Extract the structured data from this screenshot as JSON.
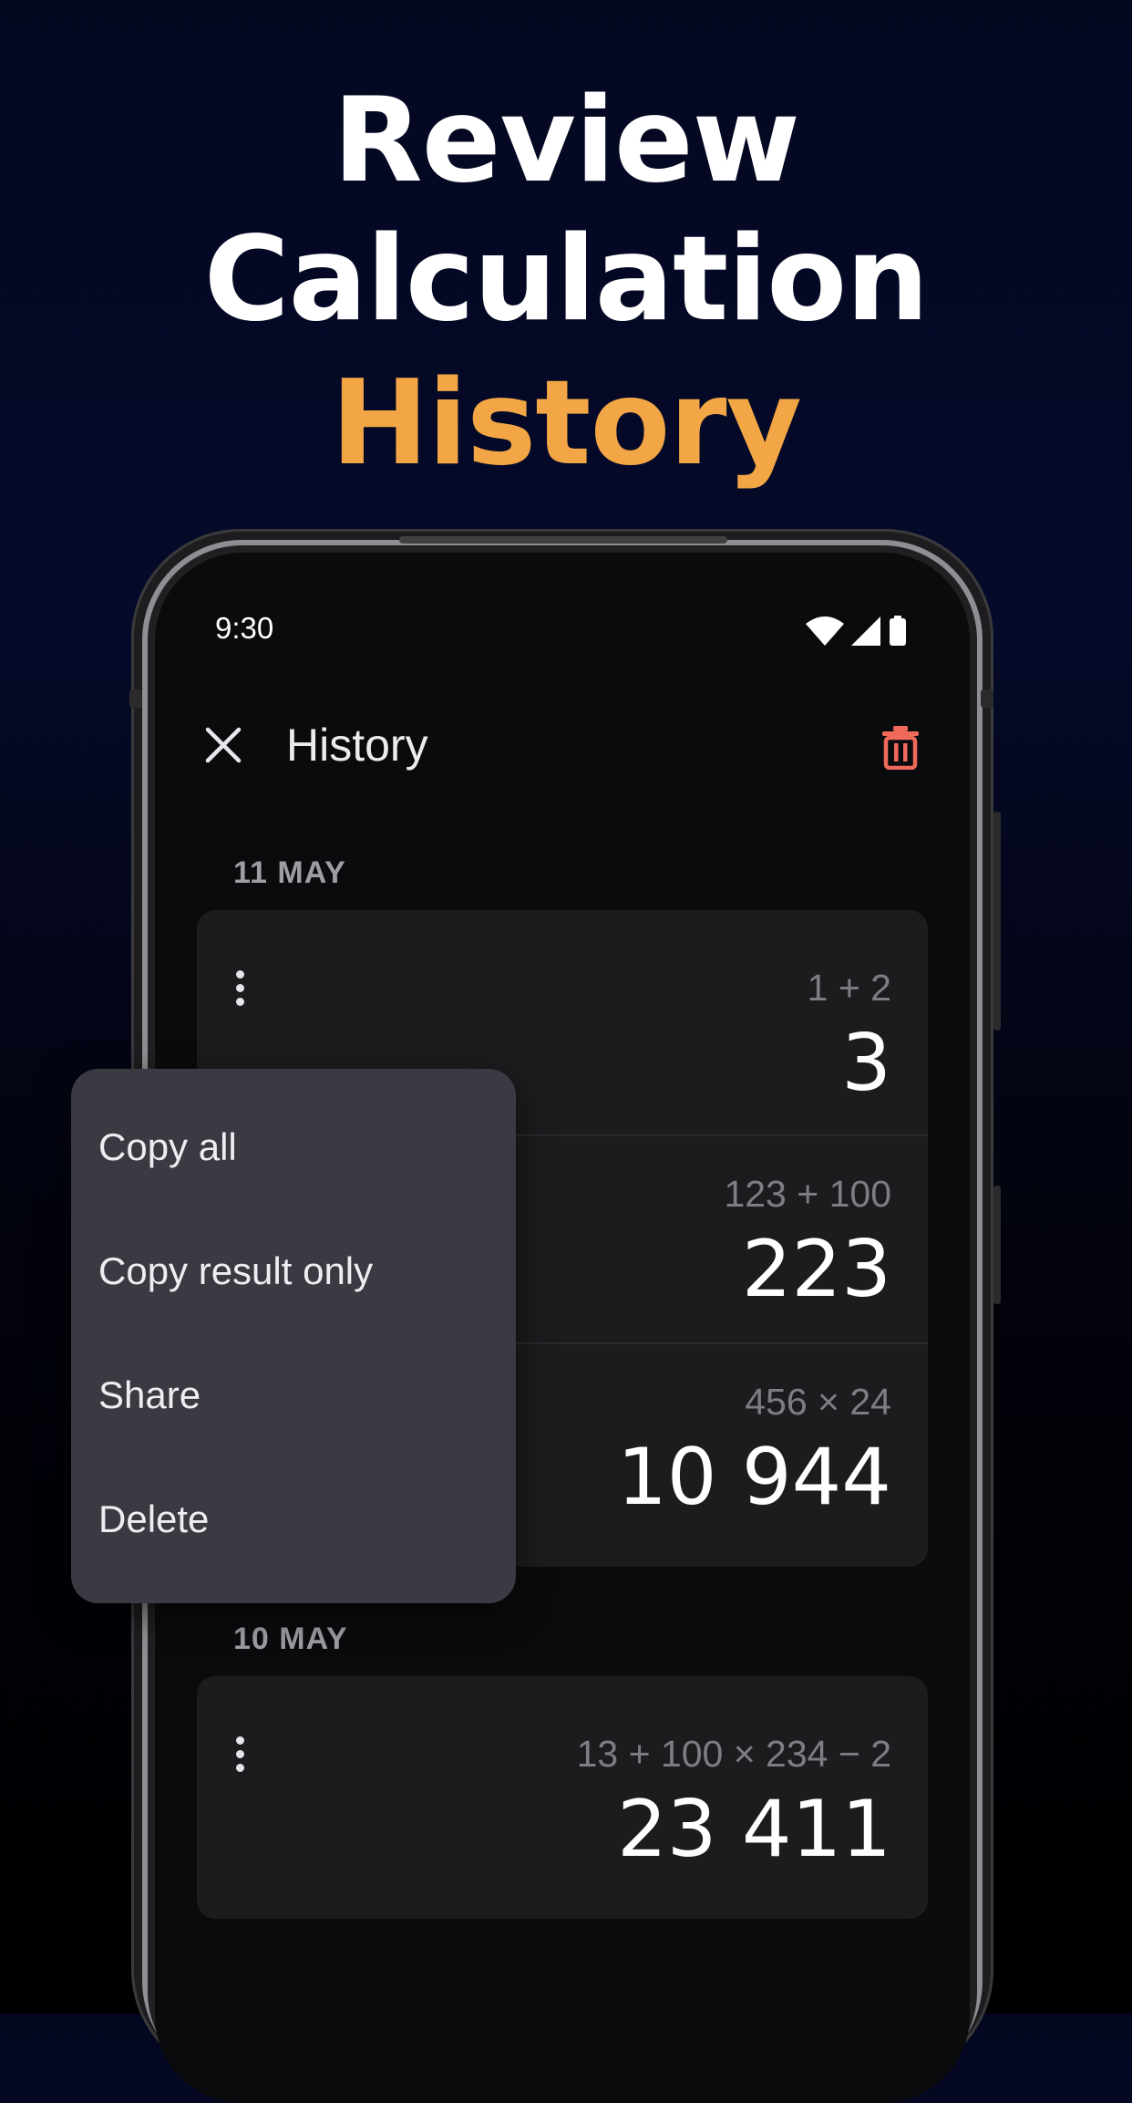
{
  "headline": {
    "line1": "Review",
    "line2": "Calculation",
    "line3": "History",
    "accent_color": "#f3a646"
  },
  "status_bar": {
    "time": "9:30",
    "icons": [
      "wifi-icon",
      "signal-icon",
      "battery-icon"
    ]
  },
  "app_bar": {
    "title": "History",
    "close_icon": "close-icon",
    "clear_icon": "trash-icon",
    "clear_icon_color": "#f06a5c"
  },
  "groups": [
    {
      "date": "11 MAY",
      "entries": [
        {
          "expression": "1 + 2",
          "result": "3"
        },
        {
          "expression": "123 + 100",
          "result": "223"
        },
        {
          "expression": "456 × 24",
          "result": "10 944"
        }
      ]
    },
    {
      "date": "10 MAY",
      "entries": [
        {
          "expression": "13 + 100 × 234 − 2",
          "result": "23 411"
        }
      ]
    }
  ],
  "context_menu": {
    "items": [
      "Copy all",
      "Copy result only",
      "Share",
      "Delete"
    ]
  }
}
